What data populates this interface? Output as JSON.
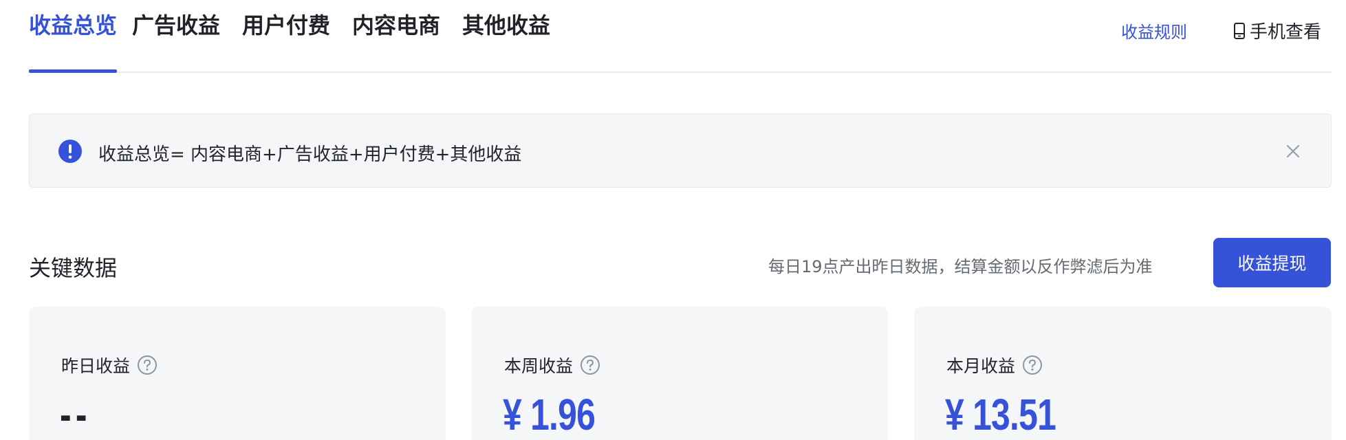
{
  "tabs": [
    {
      "label": "收益总览",
      "active": true
    },
    {
      "label": "广告收益",
      "active": false
    },
    {
      "label": "用户付费",
      "active": false
    },
    {
      "label": "内容电商",
      "active": false
    },
    {
      "label": "其他收益",
      "active": false
    }
  ],
  "header": {
    "rules_link": "收益规则",
    "mobile_view": "手机查看",
    "mobile_icon": "phone-icon"
  },
  "notice": {
    "icon": "exclamation-circle-icon",
    "text": "收益总览= 内容电商+广告收益+用户付费+其他收益",
    "close_icon": "close-icon"
  },
  "section": {
    "title": "关键数据",
    "note": "每日19点产出昨日数据，结算金额以反作弊滤后为准",
    "withdraw_button": "收益提现"
  },
  "cards": [
    {
      "label": "昨日收益",
      "value": "--"
    },
    {
      "label": "本周收益",
      "value": "¥ 1.96"
    },
    {
      "label": "本月收益",
      "value": "¥ 13.51"
    }
  ],
  "colors": {
    "accent": "#3652d9",
    "text": "#1f2329",
    "muted": "#646a73",
    "panel_bg": "#f5f6f8"
  }
}
